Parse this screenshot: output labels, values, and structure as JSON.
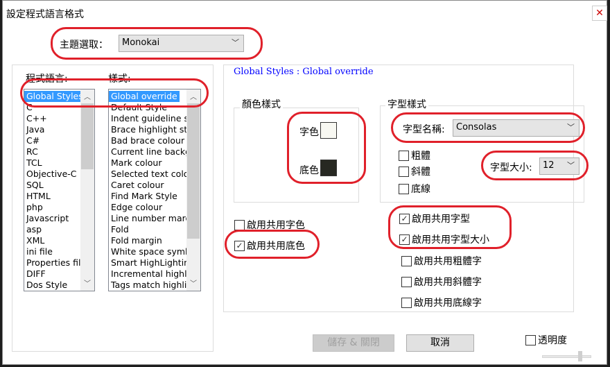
{
  "window": {
    "title": "設定程式語言格式",
    "close_icon": "close-icon"
  },
  "theme": {
    "label": "主題選取：",
    "value": "Monokai"
  },
  "languages": {
    "label": "程式語言:",
    "items": [
      "Global Styles",
      "C",
      "C++",
      "Java",
      "C#",
      "RC",
      "TCL",
      "Objective-C",
      "SQL",
      "HTML",
      "php",
      "Javascript",
      "asp",
      "XML",
      "ini file",
      "Properties file",
      "DIFF",
      "Dos Style"
    ],
    "selected": 0
  },
  "styles": {
    "label": "樣式:",
    "items": [
      "Global override",
      "Default Style",
      "Indent guideline style",
      "Brace highlight style",
      "Bad brace colour",
      "Current line background colour",
      "Mark colour",
      "Selected text colour",
      "Caret colour",
      "Find Mark Style",
      "Edge colour",
      "Line number margin",
      "Fold",
      "Fold margin",
      "White space symbol",
      "Smart HighLighting",
      "Incremental highlight",
      "Tags match highlight"
    ],
    "selected": 0
  },
  "header": "Global Styles : Global override",
  "color_style": {
    "legend": "顏色樣式",
    "fg_label": "字色",
    "fg_color": "#f8f8f2",
    "bg_label": "底色",
    "bg_color": "#272822"
  },
  "font_style": {
    "legend": "字型樣式",
    "name_label": "字型名稱:",
    "name_value": "Consolas",
    "bold": "粗體",
    "italic": "斜體",
    "underline": "底線",
    "size_label": "字型大小:",
    "size_value": "12"
  },
  "global_checks": {
    "fg": {
      "label": "啟用共用字色",
      "checked": false
    },
    "bg": {
      "label": "啟用共用底色",
      "checked": true
    },
    "font": {
      "label": "啟用共用字型",
      "checked": true
    },
    "size": {
      "label": "啟用共用字型大小",
      "checked": true
    },
    "bold": {
      "label": "啟用共用粗體字",
      "checked": false
    },
    "italic": {
      "label": "啟用共用斜體字",
      "checked": false
    },
    "underline": {
      "label": "啟用共用底線字",
      "checked": false
    }
  },
  "buttons": {
    "save": "儲存 & 關閉",
    "cancel": "取消"
  },
  "transparency": {
    "label": "透明度",
    "checked": false
  }
}
